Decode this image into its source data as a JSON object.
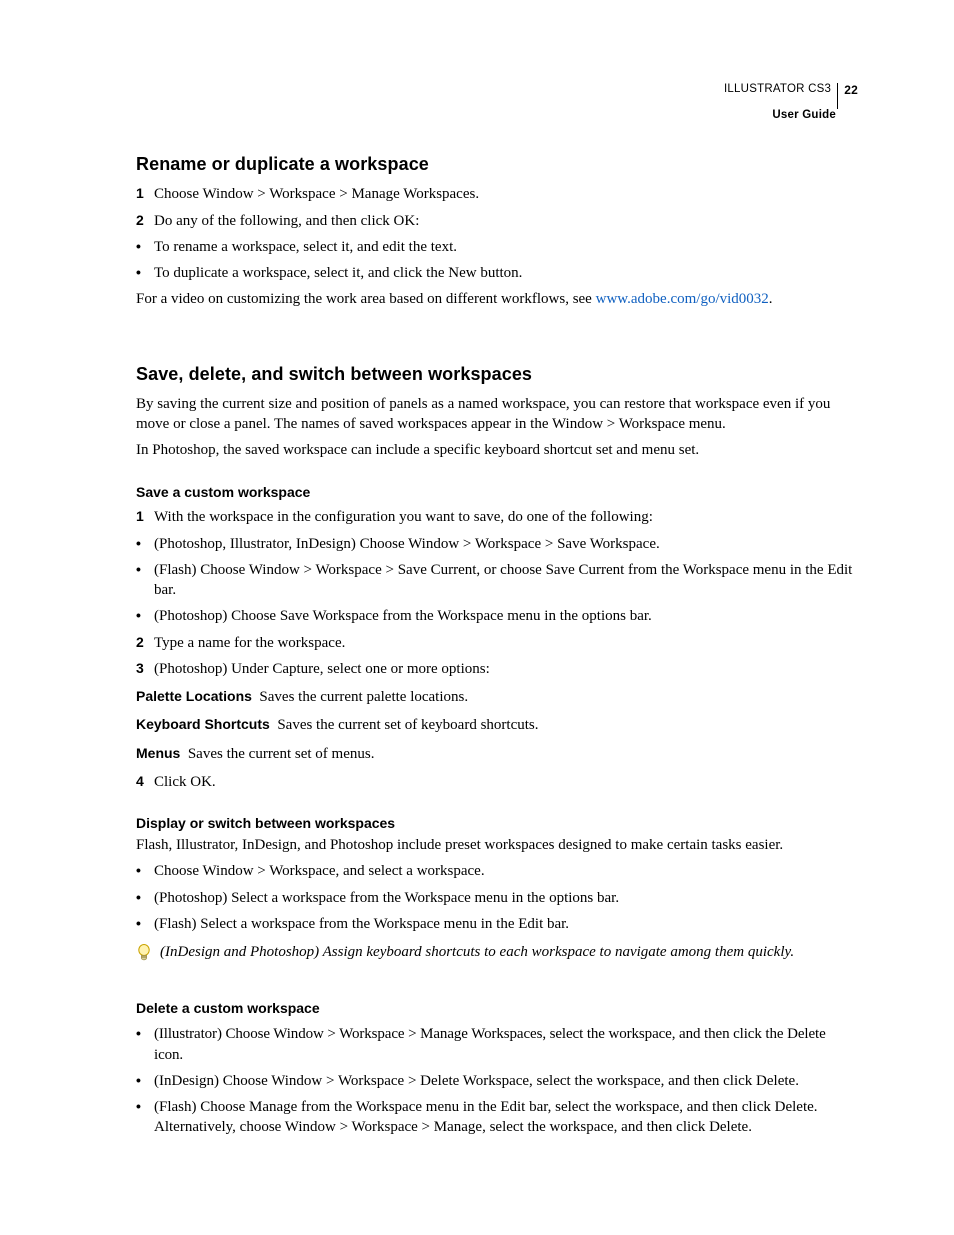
{
  "header": {
    "product": "ILLUSTRATOR CS3",
    "subtitle": "User Guide",
    "page_number": "22"
  },
  "s1": {
    "title": "Rename or duplicate a workspace",
    "step1_num": "1",
    "step1_txt": "Choose Window > Workspace > Manage Workspaces.",
    "step2_num": "2",
    "step2_txt": "Do any of the following, and then click OK:",
    "b1": "To rename a workspace, select it, and edit the text.",
    "b2": "To duplicate a workspace, select it, and click the New button.",
    "video_prefix": "For a video on customizing the work area based on different workflows, see ",
    "video_link": "www.adobe.com/go/vid0032",
    "video_suffix": "."
  },
  "s2": {
    "title": "Save, delete, and switch between workspaces",
    "intro1": "By saving the current size and position of panels as a named workspace, you can restore that workspace even if you move or close a panel. The names of saved workspaces appear in the Window > Workspace menu.",
    "intro2": "In Photoshop, the saved workspace can include a specific keyboard shortcut set and menu set."
  },
  "s3": {
    "title": "Save a custom workspace",
    "step1_num": "1",
    "step1_txt": "With the workspace in the configuration you want to save, do one of the following:",
    "b1": "(Photoshop, Illustrator, InDesign) Choose Window > Workspace > Save Workspace.",
    "b2": "(Flash) Choose Window > Workspace > Save Current, or choose Save Current from the Workspace menu in the Edit bar.",
    "b3": "(Photoshop) Choose Save Workspace from the Workspace menu in the options bar.",
    "step2_num": "2",
    "step2_txt": "Type a name for the workspace.",
    "step3_num": "3",
    "step3_txt": "(Photoshop) Under Capture, select one or more options:",
    "r1_label": "Palette Locations",
    "r1_desc": "Saves the current palette locations.",
    "r2_label": "Keyboard Shortcuts",
    "r2_desc": "Saves the current set of keyboard shortcuts.",
    "r3_label": "Menus",
    "r3_desc": "Saves the current set of menus.",
    "step4_num": "4",
    "step4_txt": "Click OK."
  },
  "s4": {
    "title": "Display or switch between workspaces",
    "intro": "Flash, Illustrator, InDesign, and Photoshop include preset workspaces designed to make certain tasks easier.",
    "b1": "Choose Window > Workspace, and select a workspace.",
    "b2": "(Photoshop) Select a workspace from the Workspace menu in the options bar.",
    "b3": "(Flash) Select a workspace from the Workspace menu in the Edit bar.",
    "tip": "(InDesign and Photoshop) Assign keyboard shortcuts to each workspace to navigate among them quickly."
  },
  "s5": {
    "title": "Delete a custom workspace",
    "b1": "(Illustrator) Choose Window > Workspace > Manage Workspaces, select the workspace, and then click the Delete icon.",
    "b2": "(InDesign) Choose Window > Workspace > Delete Workspace, select the workspace, and then click Delete.",
    "b3": "(Flash) Choose Manage from the Workspace menu in the Edit bar, select the workspace, and then click Delete. Alternatively, choose Window > Workspace > Manage, select the workspace, and then click Delete."
  },
  "glyphs": {
    "bullet": "•"
  }
}
